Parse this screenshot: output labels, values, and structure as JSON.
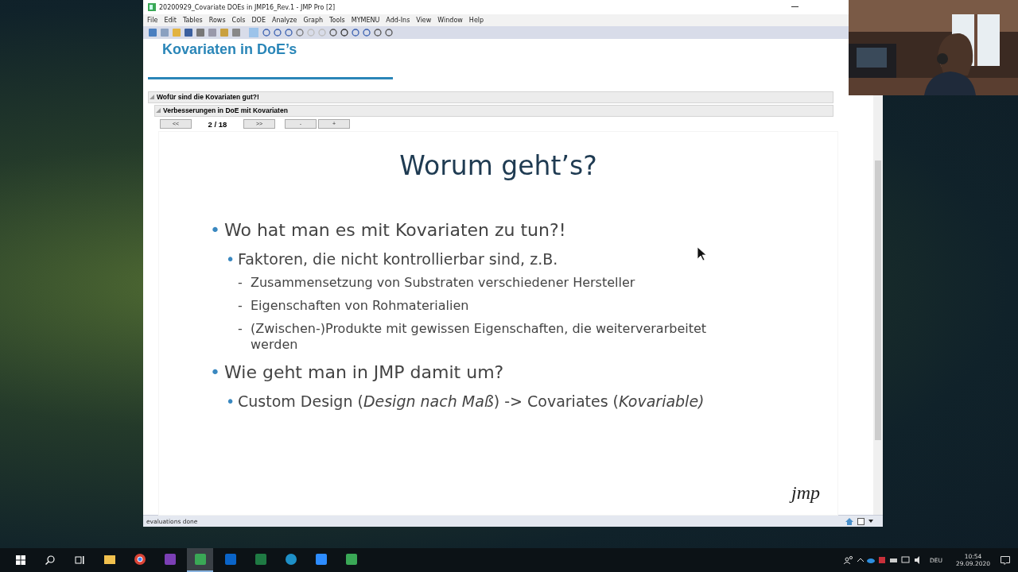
{
  "window": {
    "title": "20200929_Covariate DOEs in JMP16_Rev.1 - JMP Pro [2]"
  },
  "menu": [
    "File",
    "Edit",
    "Tables",
    "Rows",
    "Cols",
    "DOE",
    "Analyze",
    "Graph",
    "Tools",
    "MYMENU",
    "Add-Ins",
    "View",
    "Window",
    "Help"
  ],
  "report": {
    "title": "Kovariaten in DoE’s",
    "outline": [
      {
        "label": "Wofür sind die Kovariaten gut?!",
        "expanded": true,
        "children": [
          {
            "label": "Verbesserungen in DoE mit Kovariaten",
            "expanded": true
          }
        ]
      }
    ],
    "navigation": [
      {
        "kind": "button",
        "label": "<<"
      },
      {
        "kind": "counter",
        "label": "2 / 18"
      },
      {
        "kind": "button",
        "label": ">>"
      },
      {
        "kind": "button",
        "label": "-"
      },
      {
        "kind": "button",
        "label": "+"
      }
    ]
  },
  "slide": {
    "title": "Worum geht’s?",
    "bullets": [
      {
        "marker": "•",
        "text": "Wo hat man es mit Kovariaten zu tun?!",
        "children": [
          {
            "marker": "•",
            "text": "Faktoren, die nicht kontrollierbar sind, z.B.",
            "children": [
              {
                "marker": "-",
                "text": "Zusammensetzung von Substraten verschiedener Hersteller"
              },
              {
                "marker": "-",
                "text": "Eigenschaften von Rohmaterialien"
              },
              {
                "marker": "-",
                "text": "(Zwischen-)Produkte mit gewissen Eigenschaften, die weiterverarbeitet werden"
              }
            ]
          }
        ]
      },
      {
        "marker": "•",
        "text": "Wie geht man in JMP damit um?",
        "children": [
          {
            "marker": "•",
            "text": "Custom Design (*Design nach Maß*) -> Covariates (*Kovariable)*"
          }
        ]
      }
    ],
    "logo": "jmp"
  },
  "status_bar": {
    "text": "evaluations done"
  },
  "taskbar": {
    "apps": [
      {
        "kind": "folder",
        "selected": false
      },
      {
        "kind": "browser",
        "selected": false
      },
      {
        "kind": "notes",
        "selected": false
      },
      {
        "kind": "jmp",
        "selected": true
      },
      {
        "kind": "mail",
        "selected": false
      },
      {
        "kind": "sheet",
        "selected": false
      },
      {
        "kind": "edge",
        "selected": false
      },
      {
        "kind": "video",
        "selected": false
      },
      {
        "kind": "jmp",
        "selected": false
      }
    ],
    "language": "DEU",
    "time": "10:54",
    "date": "29.09.2020"
  }
}
